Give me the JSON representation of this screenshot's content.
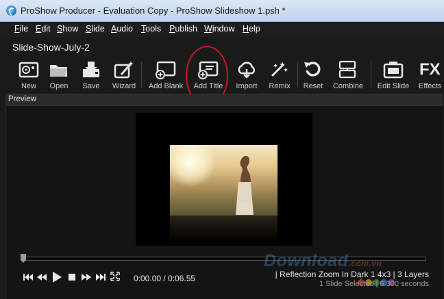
{
  "window": {
    "title": "ProShow Producer - Evaluation Copy - ProShow Slideshow 1.psh *"
  },
  "menu": [
    "File",
    "Edit",
    "Show",
    "Slide",
    "Audio",
    "Tools",
    "Publish",
    "Window",
    "Help"
  ],
  "show_name": "Slide-Show-July-2",
  "toolbar": {
    "new": "New",
    "open": "Open",
    "save": "Save",
    "wizard": "Wizard",
    "add_blank": "Add Blank",
    "add_title": "Add Title",
    "import": "Import",
    "remix": "Remix",
    "reset": "Reset",
    "combine": "Combine",
    "edit_slide": "Edit Slide",
    "effects": "Effects",
    "effects_glyph": "FX"
  },
  "preview": {
    "header": "Preview",
    "time": "0:00.00 / 0:06.55",
    "effect_info": "|  Reflection Zoom In Dark 1 4x3  |  3 Layers",
    "selection_info": "1 Slide Selected  |  6.300 seconds",
    "playhead_fraction": 0
  },
  "watermark": {
    "text": "Download",
    "suffix": ".com.vn"
  },
  "colors": {
    "highlight_ring": "#d0141f",
    "titlebar": "#bfd3ec",
    "background": "#1a1a1a"
  }
}
